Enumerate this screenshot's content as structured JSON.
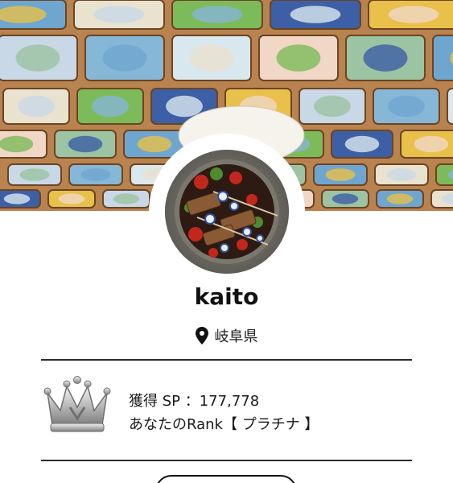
{
  "profile": {
    "username": "kaito",
    "location": "岐阜県"
  },
  "rank": {
    "sp_label": "獲得 SP ：",
    "sp_value": "177,778",
    "rank_label": "あなたのRank【 プラチナ 】"
  },
  "icons": {
    "location": "map-pin-icon",
    "rank": "platinum-crown-icon"
  },
  "colors": {
    "ceiling_wood": "#b8834e",
    "divider": "#2b2b2b",
    "text": "#111111"
  }
}
